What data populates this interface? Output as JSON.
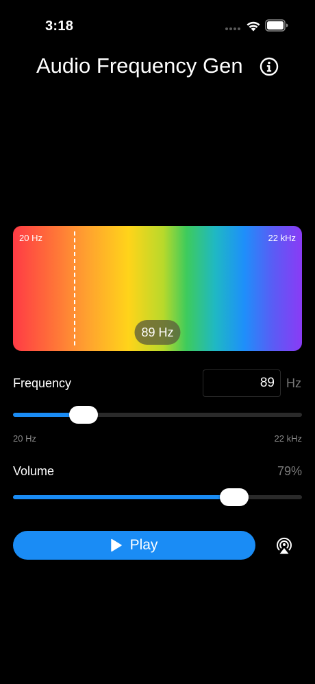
{
  "status_bar": {
    "time": "3:18"
  },
  "header": {
    "title": "Audio Frequency Gen",
    "info_icon": "info-icon"
  },
  "spectrum": {
    "min_label": "20 Hz",
    "max_label": "22 kHz",
    "current_label": "89 Hz",
    "marker_position": 0.21
  },
  "frequency": {
    "label": "Frequency",
    "value": "89",
    "unit": "Hz",
    "slider_level": 0.245,
    "min_label": "20 Hz",
    "max_label": "22 kHz"
  },
  "volume": {
    "label": "Volume",
    "value": "79%",
    "slider_level": 0.765
  },
  "controls": {
    "play_label": "Play",
    "play_icon": "play-icon",
    "airplay_icon": "airplay-icon"
  },
  "colors": {
    "accent": "#1a8cf5",
    "background": "#000000"
  }
}
